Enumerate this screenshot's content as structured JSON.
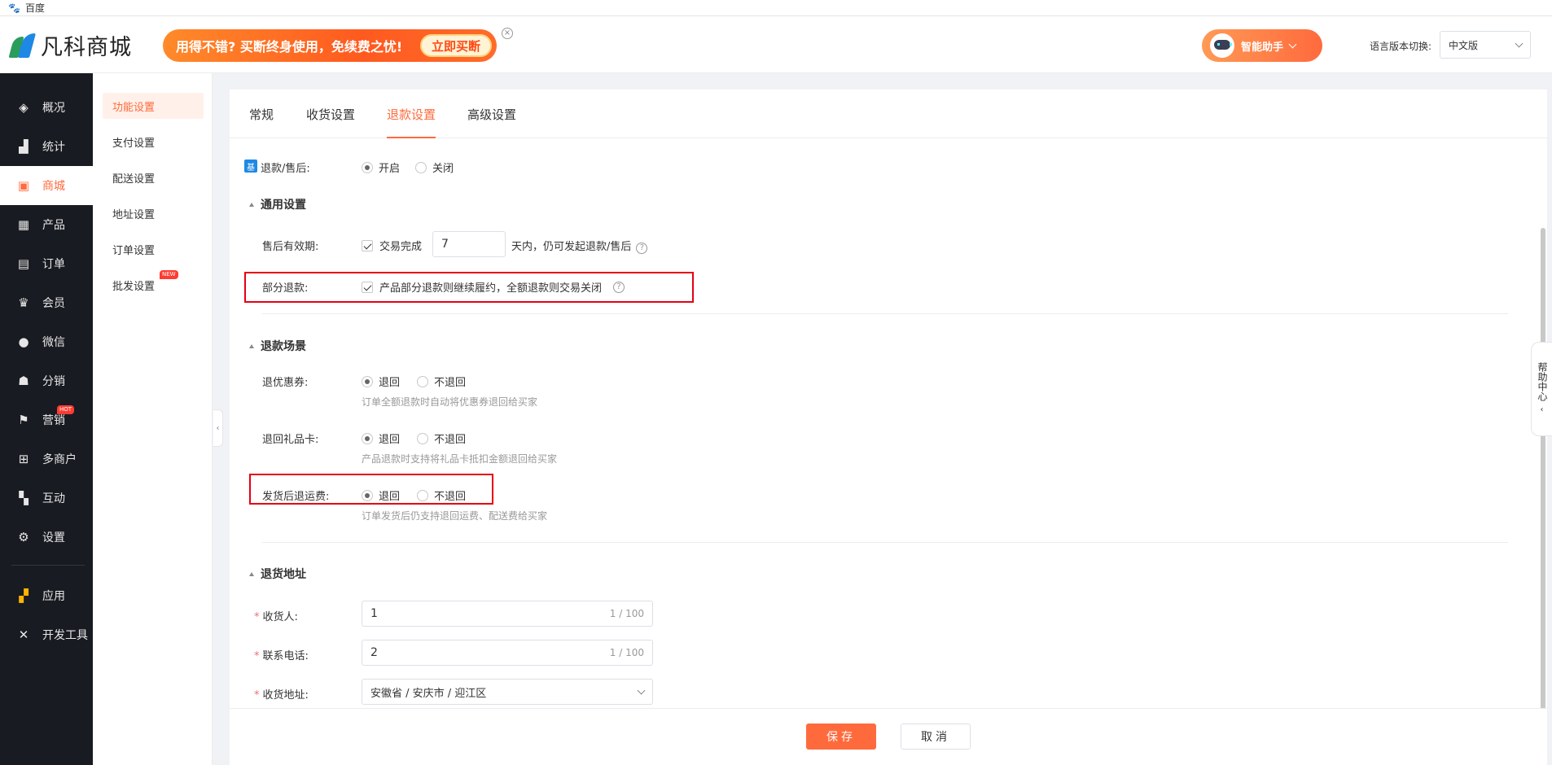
{
  "browser": {
    "tab_title": "百度"
  },
  "header": {
    "logo_text": "凡科商城",
    "promo_text": "用得不错? 买断终身使用，免续费之忧!",
    "promo_button": "立即买断",
    "assistant_label": "智能助手",
    "lang_label": "语言版本切换:",
    "lang_value": "中文版"
  },
  "sidebar": {
    "items": [
      {
        "label": "概况",
        "icon": "layers-icon"
      },
      {
        "label": "统计",
        "icon": "chart-icon"
      },
      {
        "label": "商城",
        "icon": "shop-icon",
        "active": true
      },
      {
        "label": "产品",
        "icon": "grid-icon"
      },
      {
        "label": "订单",
        "icon": "order-icon"
      },
      {
        "label": "会员",
        "icon": "crown-icon"
      },
      {
        "label": "微信",
        "icon": "wechat-icon"
      },
      {
        "label": "分销",
        "icon": "users-icon"
      },
      {
        "label": "营销",
        "icon": "flag-icon",
        "badge": "HOT"
      },
      {
        "label": "多商户",
        "icon": "store-icon"
      },
      {
        "label": "互动",
        "icon": "apps-icon"
      },
      {
        "label": "设置",
        "icon": "gear-icon"
      },
      {
        "label": "应用",
        "icon": "app-icon"
      },
      {
        "label": "开发工具",
        "icon": "tools-icon"
      }
    ]
  },
  "subnav": {
    "items": [
      {
        "label": "功能设置",
        "active": true
      },
      {
        "label": "支付设置"
      },
      {
        "label": "配送设置"
      },
      {
        "label": "地址设置"
      },
      {
        "label": "订单设置"
      },
      {
        "label": "批发设置",
        "badge": "NEW"
      }
    ]
  },
  "tabs": [
    "常规",
    "收货设置",
    "退款设置",
    "高级设置"
  ],
  "active_tab": "退款设置",
  "refund": {
    "badge": "基",
    "label": "退款/售后:",
    "on_label": "开启",
    "off_label": "关闭"
  },
  "general": {
    "title": "通用设置",
    "validity_label": "售后有效期:",
    "validity_check": "交易完成",
    "validity_days": "7",
    "validity_suffix": "天内，仍可发起退款/售后",
    "partial_label": "部分退款:",
    "partial_check": "产品部分退款则继续履约，全额退款则交易关闭"
  },
  "scenes": {
    "title": "退款场景",
    "coupon_label": "退优惠券:",
    "coupon_hint": "订单全额退款时自动将优惠券退回给买家",
    "giftcard_label": "退回礼品卡:",
    "giftcard_hint": "产品退款时支持将礼品卡抵扣金额退回给买家",
    "freight_label": "发货后退运费:",
    "freight_hint": "订单发货后仍支持退回运费、配送费给买家",
    "return_label": "退回",
    "noreturn_label": "不退回"
  },
  "address": {
    "title": "退货地址",
    "receiver_label": "收货人:",
    "receiver_value": "1",
    "receiver_count": "1 / 100",
    "phone_label": "联系电话:",
    "phone_value": "2",
    "phone_count": "1 / 100",
    "addr_label": "收货地址:",
    "addr_value": "安徽省 / 安庆市 / 迎江区"
  },
  "help_tab": "帮助中心",
  "footer": {
    "save": "保存",
    "cancel": "取消"
  },
  "colors": {
    "accent": "#ff6a3d",
    "sidebar_bg": "#191b22",
    "highlight": "#e60012"
  }
}
